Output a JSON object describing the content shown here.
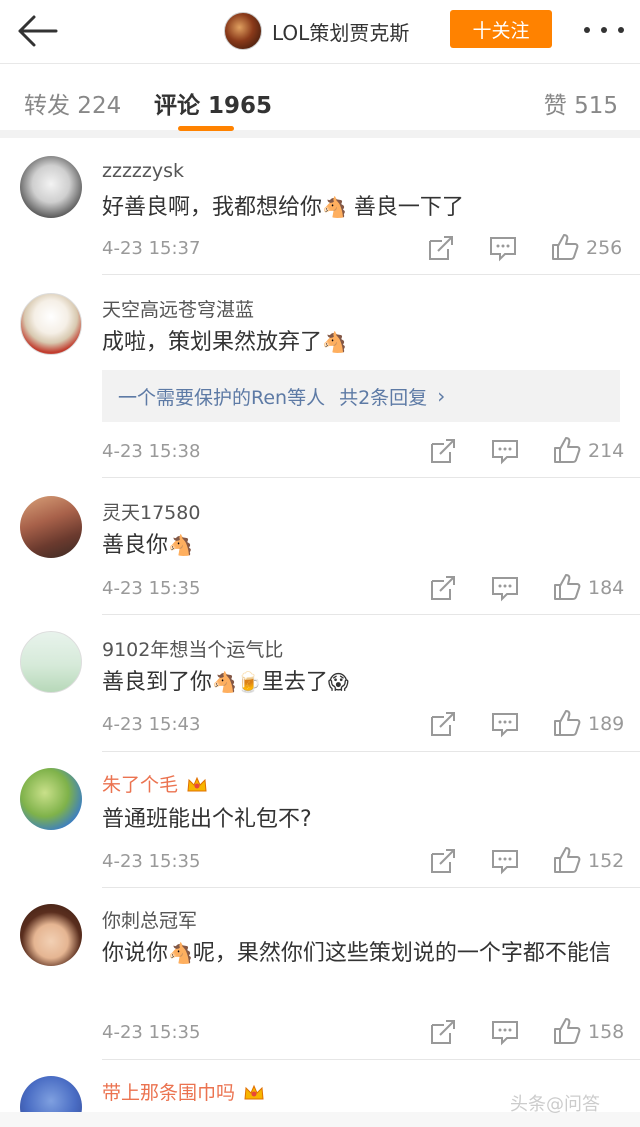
{
  "header": {
    "username": "LOL策划贾克斯",
    "follow_label": "十关注"
  },
  "tabs": {
    "repost": "转发 224",
    "comment": "评论 1965",
    "like": "赞 515"
  },
  "comments": [
    {
      "name": "zzzzzysk",
      "text_a": "好善良啊，我都想给你",
      "emoji1": "🐴",
      "text_b": " 善良一下了",
      "time": "4-23 15:37",
      "likes": "256"
    },
    {
      "name": "天空高远苍穹湛蓝",
      "text_a": "成啦，策划果然放弃了",
      "emoji1": "🐴",
      "reply_users": "一个需要保护的Ren等人",
      "reply_count": "共2条回复",
      "time": "4-23 15:38",
      "likes": "214"
    },
    {
      "name": "灵天17580",
      "text_a": "善良你",
      "emoji1": "🐴",
      "time": "4-23 15:35",
      "likes": "184"
    },
    {
      "name": "9102年想当个运气比",
      "text_a": "善良到了你",
      "emoji1": "🐴",
      "emoji2": "🍺",
      "text_b": "里去了",
      "emoji3": "😱",
      "time": "4-23 15:43",
      "likes": "189"
    },
    {
      "name": "朱了个毛",
      "text_a": "普通班能出个礼包不?",
      "time": "4-23 15:35",
      "likes": "152"
    },
    {
      "name": "你刺总冠军",
      "text_a": "你说你",
      "emoji1": "🐴",
      "text_b": "呢，果然你们这些策划说的一个字都不能信",
      "time": "4-23 15:35",
      "likes": "158"
    },
    {
      "name": "带上那条围巾吗"
    }
  ],
  "watermark": "头条@问答",
  "icons": [
    "back-arrow-icon",
    "more-dots-icon",
    "repost-icon",
    "comment-icon",
    "thumbs-up-icon",
    "crown-icon",
    "chevron-right-icon"
  ],
  "colors": {
    "accent": "#ff8200",
    "vip_name": "#eb7350",
    "link": "#5d7aa5"
  }
}
